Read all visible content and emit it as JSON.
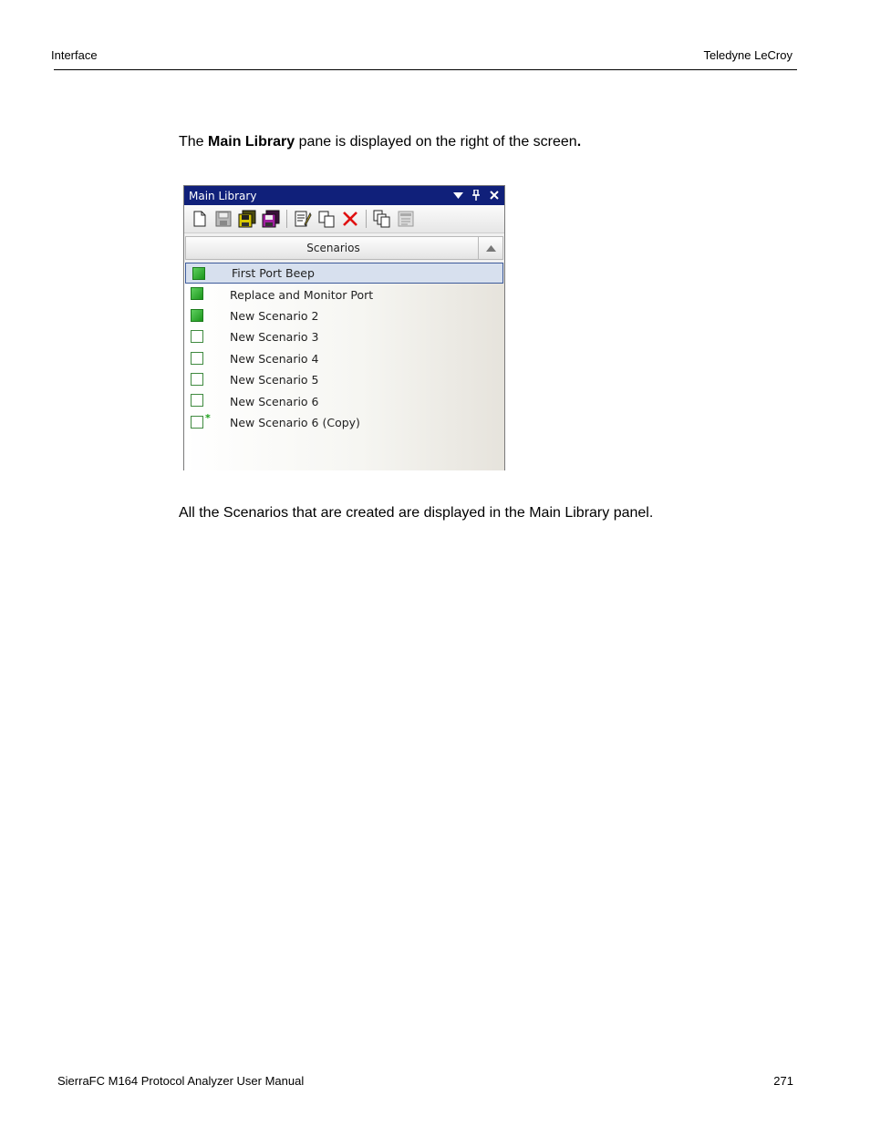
{
  "header": {
    "left": "Interface",
    "right": "Teledyne LeCroy"
  },
  "para1": {
    "pre": "The ",
    "bold": "Main Library",
    "post": " pane is displayed on the right of the screen",
    "period": "."
  },
  "pane": {
    "title": "Main Library",
    "column_header": "Scenarios",
    "toolbar_icons": [
      "new-icon",
      "save-icon",
      "save-all-icon",
      "save-as-icon",
      "edit-icon",
      "copy-icon",
      "delete-icon",
      "duplicate-icon",
      "properties-icon"
    ],
    "rows": [
      {
        "label": "First Port Beep",
        "icon": "green",
        "selected": true
      },
      {
        "label": "Replace and Monitor Port",
        "icon": "green"
      },
      {
        "label": "New Scenario 2",
        "icon": "green"
      },
      {
        "label": "New Scenario 3",
        "icon": "empty"
      },
      {
        "label": "New Scenario 4",
        "icon": "empty"
      },
      {
        "label": "New Scenario 5",
        "icon": "empty"
      },
      {
        "label": "New Scenario 6",
        "icon": "empty"
      },
      {
        "label": "New Scenario 6 (Copy)",
        "icon": "empty-new"
      }
    ]
  },
  "para2": "All the Scenarios that are created are displayed in the Main Library panel.",
  "footer": {
    "left": "SierraFC M164 Protocol Analyzer User Manual",
    "right": "271"
  },
  "colors": {
    "titlebar": "#10207a",
    "selected_border": "#3c5a9a",
    "green": "#1b961b",
    "delete_red": "#e01010"
  }
}
